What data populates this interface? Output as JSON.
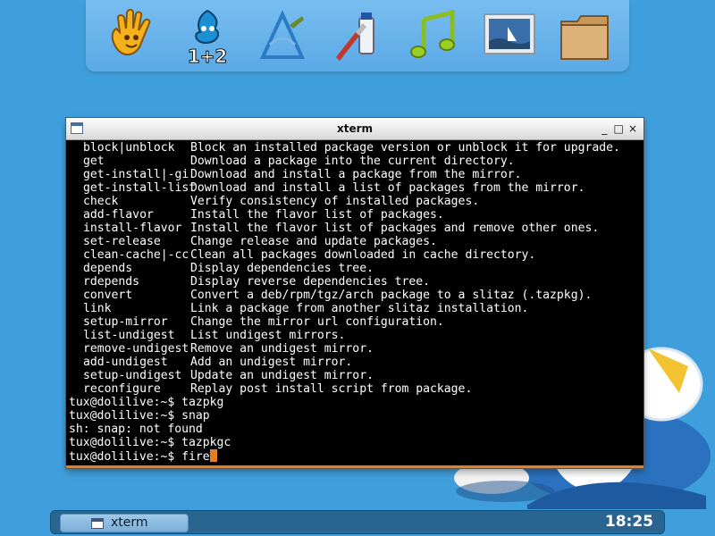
{
  "dock": {
    "items": [
      {
        "name": "hand-icon"
      },
      {
        "name": "calculator-icon",
        "label": "1+2"
      },
      {
        "name": "editor-icon"
      },
      {
        "name": "paint-icon"
      },
      {
        "name": "music-icon"
      },
      {
        "name": "image-viewer-icon"
      },
      {
        "name": "folder-icon"
      }
    ]
  },
  "window": {
    "title": "xterm",
    "buttons": [
      "_",
      "□",
      "×"
    ]
  },
  "terminal": {
    "help_rows": [
      {
        "cmd": "block|unblock",
        "desc": "Block an installed package version or unblock it for upgrade."
      },
      {
        "cmd": "get",
        "desc": "Download a package into the current directory."
      },
      {
        "cmd": "get-install|-gi",
        "desc": "Download and install a package from the mirror."
      },
      {
        "cmd": "get-install-list",
        "desc": "Download and install a list of packages from the mirror."
      },
      {
        "cmd": "check",
        "desc": "Verify consistency of installed packages."
      },
      {
        "cmd": "add-flavor",
        "desc": "Install the flavor list of packages."
      },
      {
        "cmd": "install-flavor",
        "desc": "Install the flavor list of packages and remove other ones."
      },
      {
        "cmd": "set-release",
        "desc": "Change release and update packages."
      },
      {
        "cmd": "clean-cache|-cc",
        "desc": "Clean all packages downloaded in cache directory."
      },
      {
        "cmd": "depends",
        "desc": "Display dependencies tree."
      },
      {
        "cmd": "rdepends",
        "desc": "Display reverse dependencies tree."
      },
      {
        "cmd": "convert",
        "desc": "Convert a deb/rpm/tgz/arch package to a slitaz (.tazpkg)."
      },
      {
        "cmd": "link",
        "desc": "Link a package from another slitaz installation."
      },
      {
        "cmd": "setup-mirror",
        "desc": "Change the mirror url configuration."
      },
      {
        "cmd": "list-undigest",
        "desc": "List undigest mirrors."
      },
      {
        "cmd": "remove-undigest",
        "desc": "Remove an undigest mirror."
      },
      {
        "cmd": "add-undigest",
        "desc": "Add an undigest mirror."
      },
      {
        "cmd": "setup-undigest",
        "desc": "Update an undigest mirror."
      },
      {
        "cmd": "reconfigure",
        "desc": "Replay post install script from package."
      }
    ],
    "output_lines": [
      "tux@dolilive:~$ tazpkg",
      "tux@dolilive:~$ snap",
      "sh: snap: not found",
      "tux@dolilive:~$ tazpkgc"
    ],
    "prompt": "tux@dolilive:~$ ",
    "current_input": "fire"
  },
  "taskbar": {
    "task_label": "xterm",
    "clock": "18:25"
  },
  "colors": {
    "desktop_bg": "#3f9fdc",
    "terminal_bg": "#000000",
    "terminal_fg": "#ffffff",
    "cursor": "#e67e22",
    "taskbar": "#2a6591"
  }
}
